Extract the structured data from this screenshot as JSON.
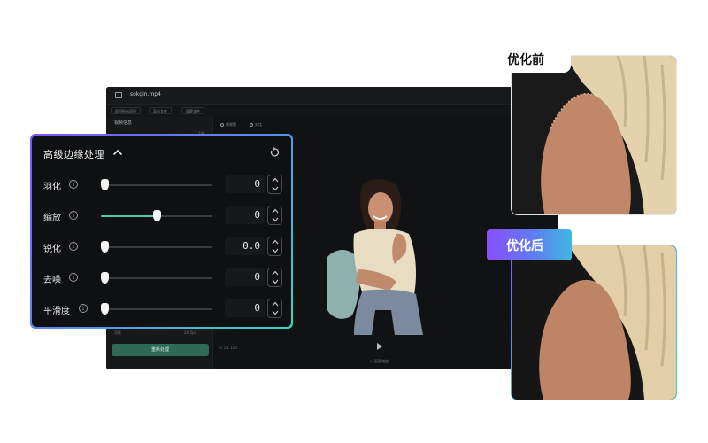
{
  "editor": {
    "filename": "sokgin.mp4",
    "toolbar": [
      "返回所有项目",
      "导出文件",
      "观察文件"
    ],
    "left_section_title": "视频信息",
    "left_small_value": "1.149",
    "left_bottom_label": "羽化",
    "left_bottom_value": "2X 5px",
    "reset_button_label": "重新处理",
    "view_tabs": [
      "原视图",
      "对比"
    ],
    "zoom_text": "⊙ 1:1 100",
    "scale_label": "○ 画面缩放"
  },
  "panel": {
    "title": "高级边缘处理",
    "rows": [
      {
        "label": "羽化",
        "value": "0",
        "level": 0.03,
        "filled": false
      },
      {
        "label": "缩放",
        "value": "0",
        "level": 0.5,
        "filled": true
      },
      {
        "label": "锐化",
        "value": "0.0",
        "level": 0.03,
        "filled": false
      },
      {
        "label": "去噪",
        "value": "0",
        "level": 0.03,
        "filled": false
      },
      {
        "label": "平滑度",
        "value": "0",
        "level": 0.03,
        "filled": false
      }
    ]
  },
  "compare": {
    "before_label": "优化前",
    "after_label": "优化后"
  },
  "colors": {
    "accent_green": "#4cc8a6",
    "gradient_start": "#7b55ff",
    "gradient_end": "#35d6c0",
    "panel_bg": "#0f1012"
  },
  "icons": [
    "sidebar-toggle-icon",
    "chevron-up-icon",
    "reset-icon",
    "info-icon",
    "stepper-up-icon",
    "stepper-down-icon",
    "play-icon"
  ]
}
